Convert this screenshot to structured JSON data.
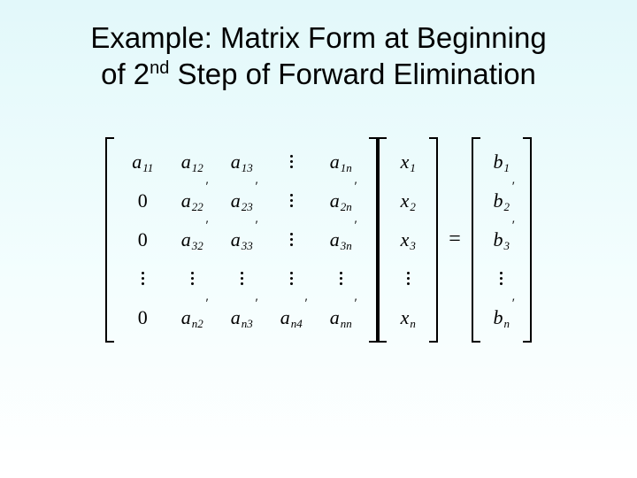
{
  "title": {
    "line1": "Example: Matrix Form at Beginning",
    "line2_pre": "of 2",
    "line2_sup": "nd",
    "line2_post": " Step of Forward Elimination"
  },
  "symbols": {
    "a": "a",
    "x": "x",
    "b": "b",
    "zero": "0",
    "equals": "="
  },
  "A": {
    "r1": {
      "c1": {
        "sub": "11"
      },
      "c2": {
        "sub": "12"
      },
      "c3": {
        "sub": "13"
      },
      "c4": "vdots",
      "c5": {
        "sub": "1n"
      }
    },
    "r2": {
      "c1": "zero",
      "c2": {
        "sub": "22",
        "prime": true
      },
      "c3": {
        "sub": "23",
        "prime": true
      },
      "c4": "vdots",
      "c5": {
        "sub": "2n",
        "prime": true
      }
    },
    "r3": {
      "c1": "zero",
      "c2": {
        "sub": "32",
        "prime": true
      },
      "c3": {
        "sub": "33",
        "prime": true
      },
      "c4": "vdots",
      "c5": {
        "sub": "3n",
        "prime": true
      }
    },
    "r4": {
      "c1": "vdots",
      "c2": "vdots",
      "c3": "vdots",
      "c4": "vdots",
      "c5": "vdots"
    },
    "r5": {
      "c1": "zero",
      "c2": {
        "sub": "n2",
        "prime": true
      },
      "c3": {
        "sub": "n3",
        "prime": true
      },
      "c4": {
        "sub": "n4",
        "prime": true
      },
      "c5": {
        "sub": "nn",
        "prime": true
      }
    }
  },
  "xvec": {
    "r1": {
      "sub": "1"
    },
    "r2": {
      "sub": "2"
    },
    "r3": {
      "sub": "3"
    },
    "r4": "vdots",
    "r5": {
      "sub": "n"
    }
  },
  "bvec": {
    "r1": {
      "sub": "1"
    },
    "r2": {
      "sub": "2",
      "prime": true
    },
    "r3": {
      "sub": "3",
      "prime": true
    },
    "r4": "vdots",
    "r5": {
      "sub": "n",
      "prime": true
    }
  }
}
